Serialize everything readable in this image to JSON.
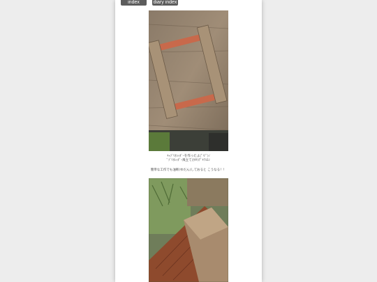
{
  "nav": {
    "index_label": "index",
    "diary_index_label": "diary index"
  },
  "entry": {
    "caption_line1": "ｷｬﾌﾞﾘｵﾚｯﾀﾞｰを作ったよ(ﾟ∀ﾟ)ﾉ",
    "caption_line2": "ﾟﾌﾞﾘｵﾚｯﾀﾞｰ風立て(ｶｾｾ)ﾃﾞｷﾃﾙﾖ♪",
    "caption_line3": "簡単な工作でも油断(ゆだん)しておると こうなる！！"
  },
  "photos": [
    {
      "subject": "wooden-frame-photo"
    },
    {
      "subject": "wood-block-closeup-photo"
    }
  ],
  "colors": {
    "background": "#ededed",
    "page": "#ffffff",
    "nav_button": "#5c5c5c",
    "caption_text": "#555555"
  }
}
